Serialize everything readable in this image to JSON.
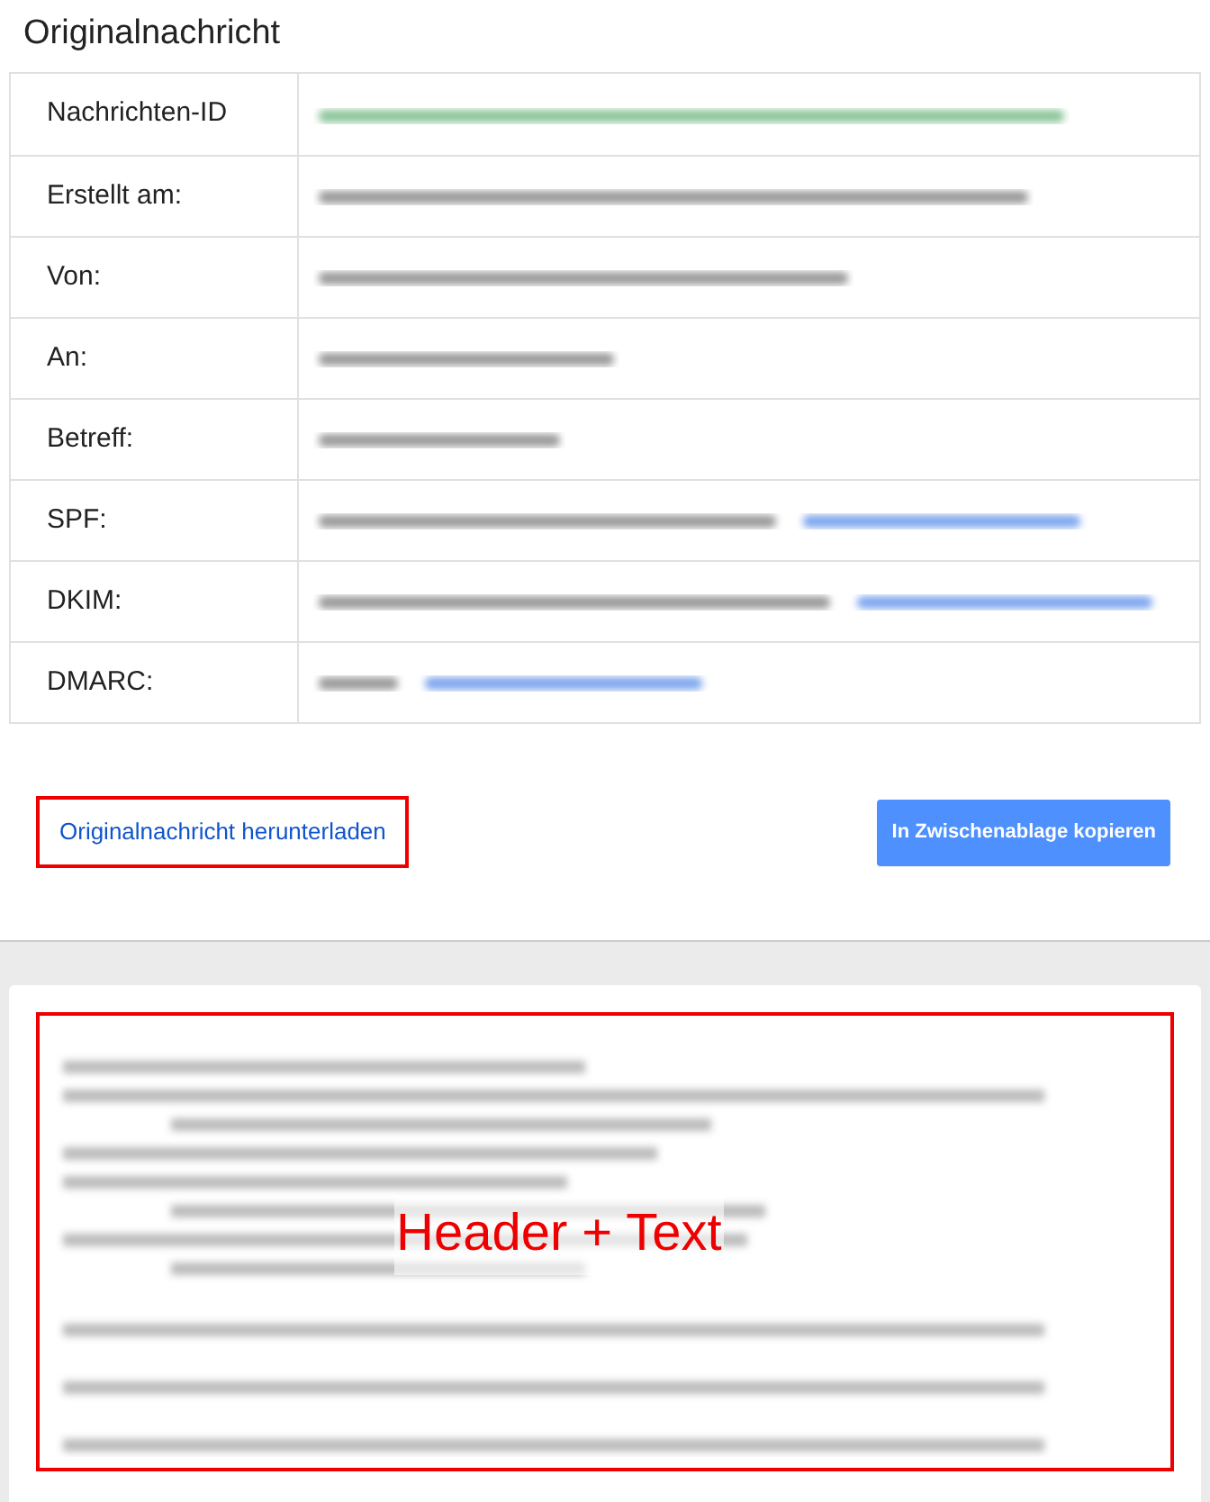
{
  "title": "Originalnachricht",
  "rows": [
    {
      "label": "Nachrichten-ID",
      "kind": "id"
    },
    {
      "label": "Erstellt am:",
      "kind": "plain"
    },
    {
      "label": "Von:",
      "kind": "plain"
    },
    {
      "label": "An:",
      "kind": "plain"
    },
    {
      "label": "Betreff:",
      "kind": "plain"
    },
    {
      "label": "SPF:",
      "kind": "link"
    },
    {
      "label": "DKIM:",
      "kind": "link"
    },
    {
      "label": "DMARC:",
      "kind": "link"
    }
  ],
  "download_link": "Originalnachricht herunterladen",
  "copy_button": "In Zwischenablage kopieren",
  "annotation": "Header + Text"
}
